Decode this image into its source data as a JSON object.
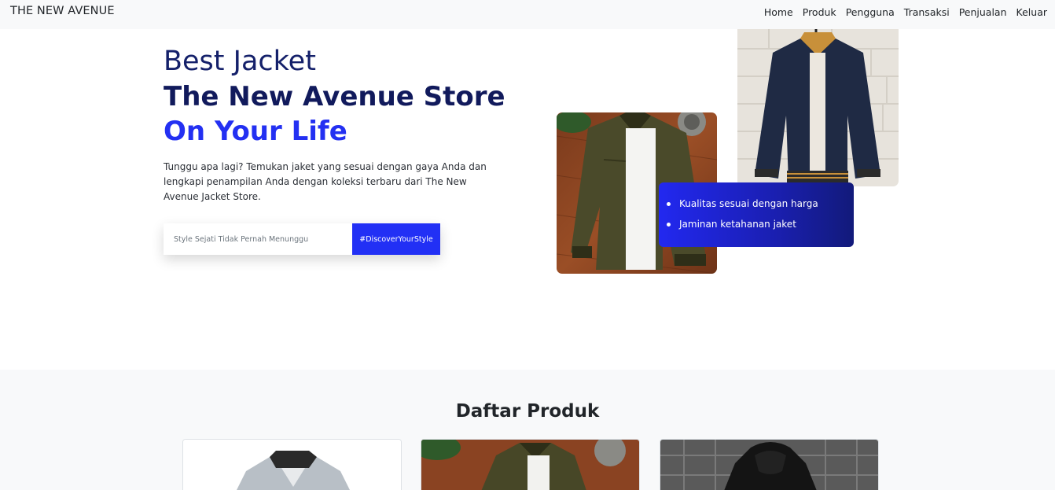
{
  "navbar": {
    "brand": "THE NEW AVENUE",
    "links": [
      "Home",
      "Produk",
      "Pengguna",
      "Transaksi",
      "Penjualan",
      "Keluar"
    ]
  },
  "hero": {
    "line1": "Best Jacket",
    "line2": "The New Avenue Store",
    "line3": "On Your Life",
    "description": "Tunggu apa lagi? Temukan jaket yang sesuai dengan gaya Anda dan lengkapi penampilan Anda dengan koleksi terbaru dari The New Avenue Jacket Store.",
    "search_placeholder": "Style Sejati Tidak Pernah Menunggu",
    "search_button": "#DiscoverYourStyle"
  },
  "features": [
    "Kualitas sesuai dengan harga",
    "Jaminan ketahanan jaket"
  ],
  "products": {
    "title": "Daftar Produk"
  },
  "colors": {
    "accent_blue": "#2230f5",
    "navy_text": "#111a5c",
    "navbar_bg": "#f8f9fa"
  }
}
